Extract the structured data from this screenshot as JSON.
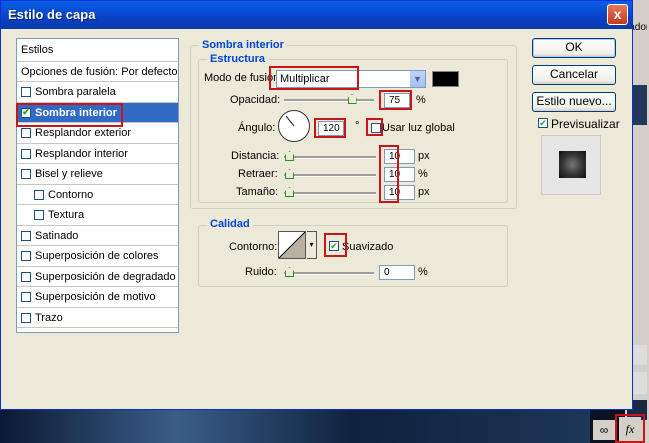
{
  "window": {
    "title": "Estilo de capa",
    "close_glyph": "x"
  },
  "left_panel": {
    "header": "Estilos",
    "items": [
      {
        "label": "Opciones de fusión: Por defecto",
        "checkbox": false,
        "checked": false
      },
      {
        "label": "Sombra paralela",
        "checkbox": true,
        "checked": false
      },
      {
        "label": "Sombra interior",
        "checkbox": true,
        "checked": true,
        "selected": true
      },
      {
        "label": "Resplandor exterior",
        "checkbox": true,
        "checked": false
      },
      {
        "label": "Resplandor interior",
        "checkbox": true,
        "checked": false
      },
      {
        "label": "Bisel y relieve",
        "checkbox": true,
        "checked": false
      },
      {
        "label": "Contorno",
        "checkbox": true,
        "checked": false,
        "indent": true
      },
      {
        "label": "Textura",
        "checkbox": true,
        "checked": false,
        "indent": true
      },
      {
        "label": "Satinado",
        "checkbox": true,
        "checked": false
      },
      {
        "label": "Superposición de colores",
        "checkbox": true,
        "checked": false
      },
      {
        "label": "Superposición de degradado",
        "checkbox": true,
        "checked": false
      },
      {
        "label": "Superposición de motivo",
        "checkbox": true,
        "checked": false
      },
      {
        "label": "Trazo",
        "checkbox": true,
        "checked": false
      }
    ]
  },
  "section": {
    "title": "Sombra interior",
    "structure": {
      "title": "Estructura",
      "blend_mode_label": "Modo de fusión:",
      "blend_mode_value": "Multiplicar",
      "blend_color": "#000000",
      "opacity_label": "Opacidad:",
      "opacity_value": "75",
      "opacity_unit": "%",
      "opacity_level": 0.75,
      "angle_label": "Ángulo:",
      "angle_value": "120",
      "angle_unit": "°",
      "global_light_label": "Usar luz global",
      "global_light_checked": false,
      "distance_label": "Distancia:",
      "distance_value": "10",
      "distance_unit": "px",
      "choke_label": "Retraer:",
      "choke_value": "10",
      "choke_unit": "%",
      "size_label": "Tamaño:",
      "size_value": "10",
      "size_unit": "px"
    },
    "quality": {
      "title": "Calidad",
      "contour_label": "Contorno:",
      "antialias_label": "Suavizado",
      "antialias_checked": true,
      "noise_label": "Ruido:",
      "noise_value": "0",
      "noise_unit": "%"
    }
  },
  "buttons": {
    "ok": "OK",
    "cancel": "Cancelar",
    "new_style": "Estilo nuevo...",
    "preview_label": "Previsualizar",
    "preview_checked": true
  },
  "background_app": {
    "text_fragment": "lador",
    "fx_label": "fx"
  },
  "colors": {
    "highlight_red": "#c8141b",
    "selection_blue": "#316ac5",
    "group_title_blue": "#0046d5"
  }
}
